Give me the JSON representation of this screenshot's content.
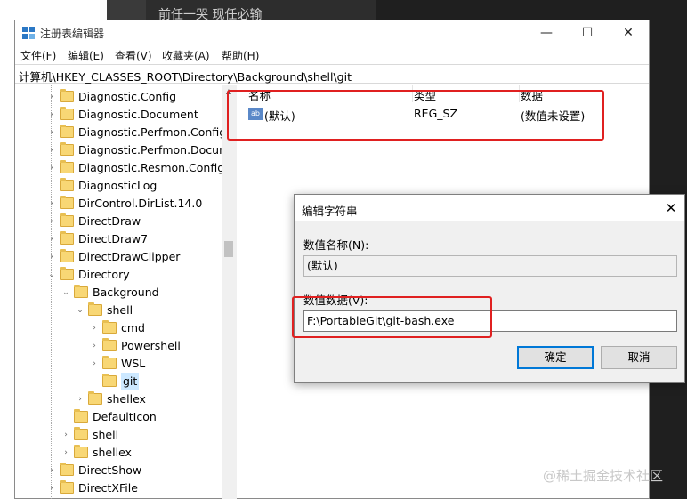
{
  "background": {
    "top_text": "前任一哭  现任必输"
  },
  "window": {
    "title": "注册表编辑器",
    "controls": {
      "minimize": "—",
      "maximize": "☐",
      "close": "✕"
    },
    "menu": [
      "文件(F)",
      "编辑(E)",
      "查看(V)",
      "收藏夹(A)",
      "帮助(H)"
    ],
    "address": "计算机\\HKEY_CLASSES_ROOT\\Directory\\Background\\shell\\git"
  },
  "tree": [
    {
      "label": "Diagnostic.Config",
      "expander": "›"
    },
    {
      "label": "Diagnostic.Document",
      "expander": "›"
    },
    {
      "label": "Diagnostic.Perfmon.Config",
      "expander": "›"
    },
    {
      "label": "Diagnostic.Perfmon.Document",
      "expander": "›"
    },
    {
      "label": "Diagnostic.Resmon.Config",
      "expander": "›"
    },
    {
      "label": "DiagnosticLog",
      "expander": ""
    },
    {
      "label": "DirControl.DirList.14.0",
      "expander": "›"
    },
    {
      "label": "DirectDraw",
      "expander": "›"
    },
    {
      "label": "DirectDraw7",
      "expander": "›"
    },
    {
      "label": "DirectDrawClipper",
      "expander": "›"
    },
    {
      "label": "Directory",
      "expander": "⌄"
    },
    {
      "label": "Background",
      "expander": "⌄"
    },
    {
      "label": "shell",
      "expander": "⌄"
    },
    {
      "label": "cmd",
      "expander": "›"
    },
    {
      "label": "Powershell",
      "expander": "›"
    },
    {
      "label": "WSL",
      "expander": "›"
    },
    {
      "label": "git",
      "expander": ""
    },
    {
      "label": "shellex",
      "expander": "›"
    },
    {
      "label": "DefaultIcon",
      "expander": ""
    },
    {
      "label": "shell",
      "expander": "›"
    },
    {
      "label": "shellex",
      "expander": "›"
    },
    {
      "label": "DirectShow",
      "expander": "›"
    },
    {
      "label": "DirectXFile",
      "expander": "›"
    }
  ],
  "list": {
    "headers": {
      "name": "名称",
      "type": "类型",
      "data": "数据"
    },
    "rows": [
      {
        "icon": "ab",
        "name": "(默认)",
        "type": "REG_SZ",
        "data": "(数值未设置)"
      }
    ]
  },
  "dialog": {
    "title": "编辑字符串",
    "close": "✕",
    "value_name_label": "数值名称(N):",
    "value_name": "(默认)",
    "value_data_label": "数值数据(V):",
    "value_data": "F:\\PortableGit\\git-bash.exe",
    "ok": "确定",
    "cancel": "取消"
  },
  "watermark": "@稀土掘金技术社区",
  "colors": {
    "highlight": "#e02020",
    "selection": "#cce8ff",
    "folder": "#f8d775",
    "accent": "#0078d7"
  }
}
